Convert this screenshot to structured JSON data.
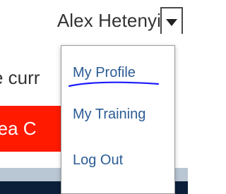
{
  "header": {
    "user_name": "Alex Hetenyi"
  },
  "background": {
    "partial_text": "e curr",
    "banner_text": "rea C"
  },
  "user_menu": {
    "items": [
      {
        "label": "My Profile"
      },
      {
        "label": "My Training"
      },
      {
        "label": "Log Out"
      }
    ]
  },
  "colors": {
    "menu_link": "#2b5c94",
    "banner": "#ff1a00",
    "annotation": "#1a1aff"
  },
  "icons": {
    "dropdown": "chevron-down-icon"
  }
}
